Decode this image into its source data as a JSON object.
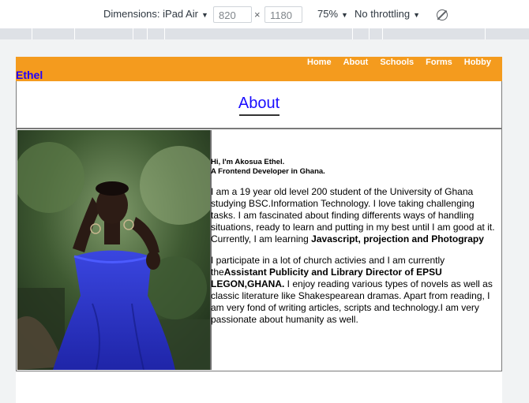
{
  "devtools": {
    "dimensions_label": "Dimensions: iPad Air",
    "width_value": "820",
    "times": "×",
    "height_value": "1180",
    "zoom": "75%",
    "throttling": "No throttling"
  },
  "site": {
    "brand": "Ethel",
    "nav": [
      "Home",
      "About",
      "Schools",
      "Forms",
      "Hobby"
    ],
    "page_title": "About",
    "intro_line1": "Hi, I'm Akosua Ethel.",
    "intro_line2": "A Frontend Developer in Ghana.",
    "para1_text": "I am a 19 year old level 200 student of the University of Ghana studying BSC.Information Technology. I love taking challenging tasks. I am fascinated about finding differents ways of handling situations, ready to learn and putting in my best until I am good at it. Currently, I am learning ",
    "para1_bold": "Javascript, projection and Photograpy",
    "para2_start": "I participate in a lot of church activies and I am currently the",
    "para2_bold": "Assistant Publicity and Library Director of EPSU LEGON,GHANA.",
    "para2_end": " I enjoy reading various types of novels as well as classic literature like Shakespearean dramas. Apart from reading, I am very fond of writing articles, scripts and technology.I am very passionate about humanity as well."
  },
  "colors": {
    "navbar": "#f49b1e",
    "brand": "#2000ff",
    "title_link": "#1a0dff"
  }
}
